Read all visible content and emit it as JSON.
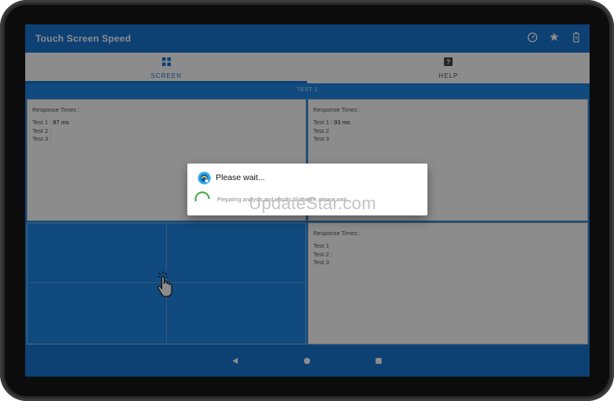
{
  "app": {
    "title": "Touch Screen Speed"
  },
  "toolbar_icons": [
    "speedometer-icon",
    "star-icon",
    "battery-icon"
  ],
  "tabs": [
    {
      "label": "SCREEN",
      "icon": "grid-icon",
      "active": true
    },
    {
      "label": "HELP",
      "icon": "help-icon",
      "active": false
    }
  ],
  "strip": {
    "label": "TEST 1"
  },
  "panels": {
    "top_left": {
      "title": "Response Times :",
      "lines": [
        "Test 1 : ",
        "Test 2 :",
        "Test 3 :"
      ],
      "values": [
        "87 ms",
        "",
        ""
      ]
    },
    "top_right": {
      "title": "Response Times :",
      "lines": [
        "Test 1 : ",
        "Test 2",
        "Test 3"
      ],
      "values": [
        "93 ms",
        "",
        ""
      ]
    },
    "bottom_right": {
      "title": "Response Times :",
      "lines": [
        "Test 1",
        "Test 2 :",
        "Test 3"
      ],
      "values": [
        "",
        "",
        ""
      ]
    }
  },
  "dialog": {
    "title": "Please wait...",
    "message": "Preparing analysis and results. Software, please wait...",
    "spinner_color": "#4caf50"
  },
  "watermark": "UpdateStar.com",
  "navbar": [
    "back-icon",
    "home-icon",
    "recents-icon"
  ],
  "colors": {
    "primary": "#1976d2",
    "accent": "#1e88e5"
  }
}
